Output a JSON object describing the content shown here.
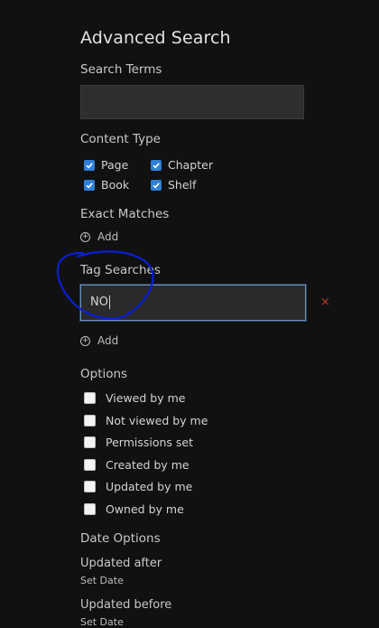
{
  "title": "Advanced Search",
  "search_terms": {
    "label": "Search Terms",
    "value": ""
  },
  "content_type": {
    "label": "Content Type",
    "items": [
      {
        "label": "Page",
        "checked": true
      },
      {
        "label": "Chapter",
        "checked": true
      },
      {
        "label": "Book",
        "checked": true
      },
      {
        "label": "Shelf",
        "checked": true
      }
    ]
  },
  "exact_matches": {
    "label": "Exact Matches",
    "add_label": "Add"
  },
  "tag_searches": {
    "label": "Tag Searches",
    "value": "NO",
    "add_label": "Add",
    "remove_glyph": "×"
  },
  "options": {
    "label": "Options",
    "items": [
      {
        "label": "Viewed by me",
        "checked": false
      },
      {
        "label": "Not viewed by me",
        "checked": false
      },
      {
        "label": "Permissions set",
        "checked": false
      },
      {
        "label": "Created by me",
        "checked": false
      },
      {
        "label": "Updated by me",
        "checked": false
      },
      {
        "label": "Owned by me",
        "checked": false
      }
    ]
  },
  "date_options": {
    "label": "Date Options",
    "updated_after": {
      "label": "Updated after",
      "action": "Set Date"
    },
    "updated_before": {
      "label": "Updated before",
      "action": "Set Date"
    }
  },
  "colors": {
    "accent": "#2f7fd6",
    "background": "#111111",
    "annotation": "#0a1fd6",
    "remove": "#c0392b"
  }
}
